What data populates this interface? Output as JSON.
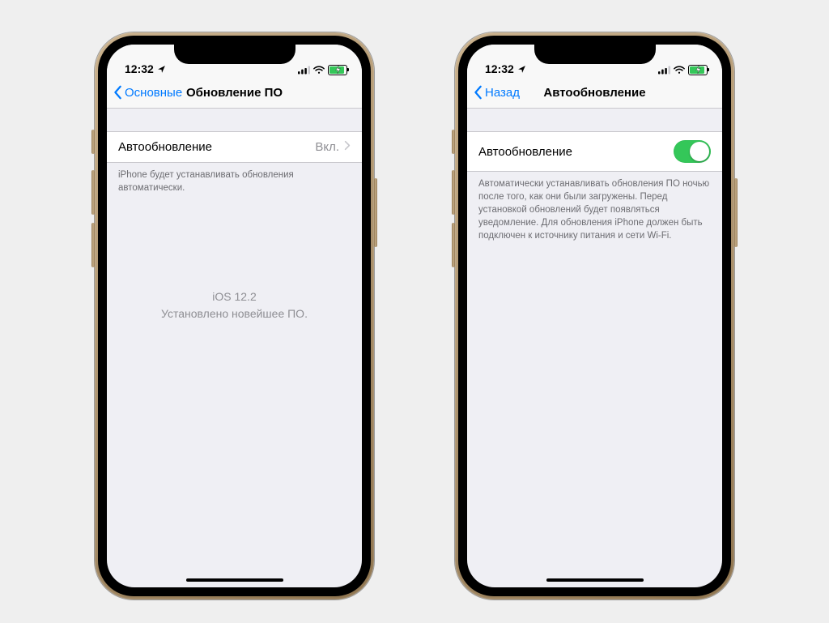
{
  "status": {
    "time": "12:32",
    "battery_pct": 80
  },
  "colors": {
    "ios_blue": "#007aff",
    "ios_green": "#34c759",
    "separator": "#c8c7cc",
    "bg": "#efeff4"
  },
  "left_screen": {
    "nav_back": "Основные",
    "nav_title": "Обновление ПО",
    "row_label": "Автообновление",
    "row_value": "Вкл.",
    "footer": "iPhone будет устанавливать обновления автоматически.",
    "center_line1": "iOS 12.2",
    "center_line2": "Установлено новейшее ПО."
  },
  "right_screen": {
    "nav_back": "Назад",
    "nav_title": "Автообновление",
    "row_label": "Автообновление",
    "toggle_on": true,
    "footer": "Автоматически устанавливать обновления ПО ночью после того, как они были загружены. Перед установкой обновлений будет появляться уведомление. Для обновления iPhone должен быть подключен к источнику питания и сети Wi-Fi."
  }
}
